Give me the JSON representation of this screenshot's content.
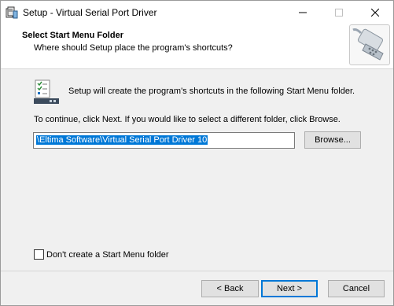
{
  "window": {
    "title": "Setup - Virtual Serial Port Driver"
  },
  "header": {
    "title": "Select Start Menu Folder",
    "subtitle": "Where should Setup place the program's shortcuts?"
  },
  "body": {
    "info": "Setup will create the program's shortcuts in the following Start Menu folder.",
    "instruction": "To continue, click Next. If you would like to select a different folder, click Browse.",
    "folder_path": "\\Eltima Software\\Virtual Serial Port Driver 10",
    "browse_label": "Browse...",
    "checkbox_label": "Don't create a Start Menu folder",
    "checkbox_checked": false
  },
  "footer": {
    "back_label": "< Back",
    "next_label": "Next >",
    "cancel_label": "Cancel"
  },
  "icons": {
    "app": "installer-icon",
    "header": "serial-port-connector-icon",
    "info": "start-menu-folder-icon"
  },
  "colors": {
    "accent": "#0078d7",
    "selection": "#0078d7",
    "dialog_bg": "#f0f0f0",
    "header_bg": "#ffffff"
  }
}
